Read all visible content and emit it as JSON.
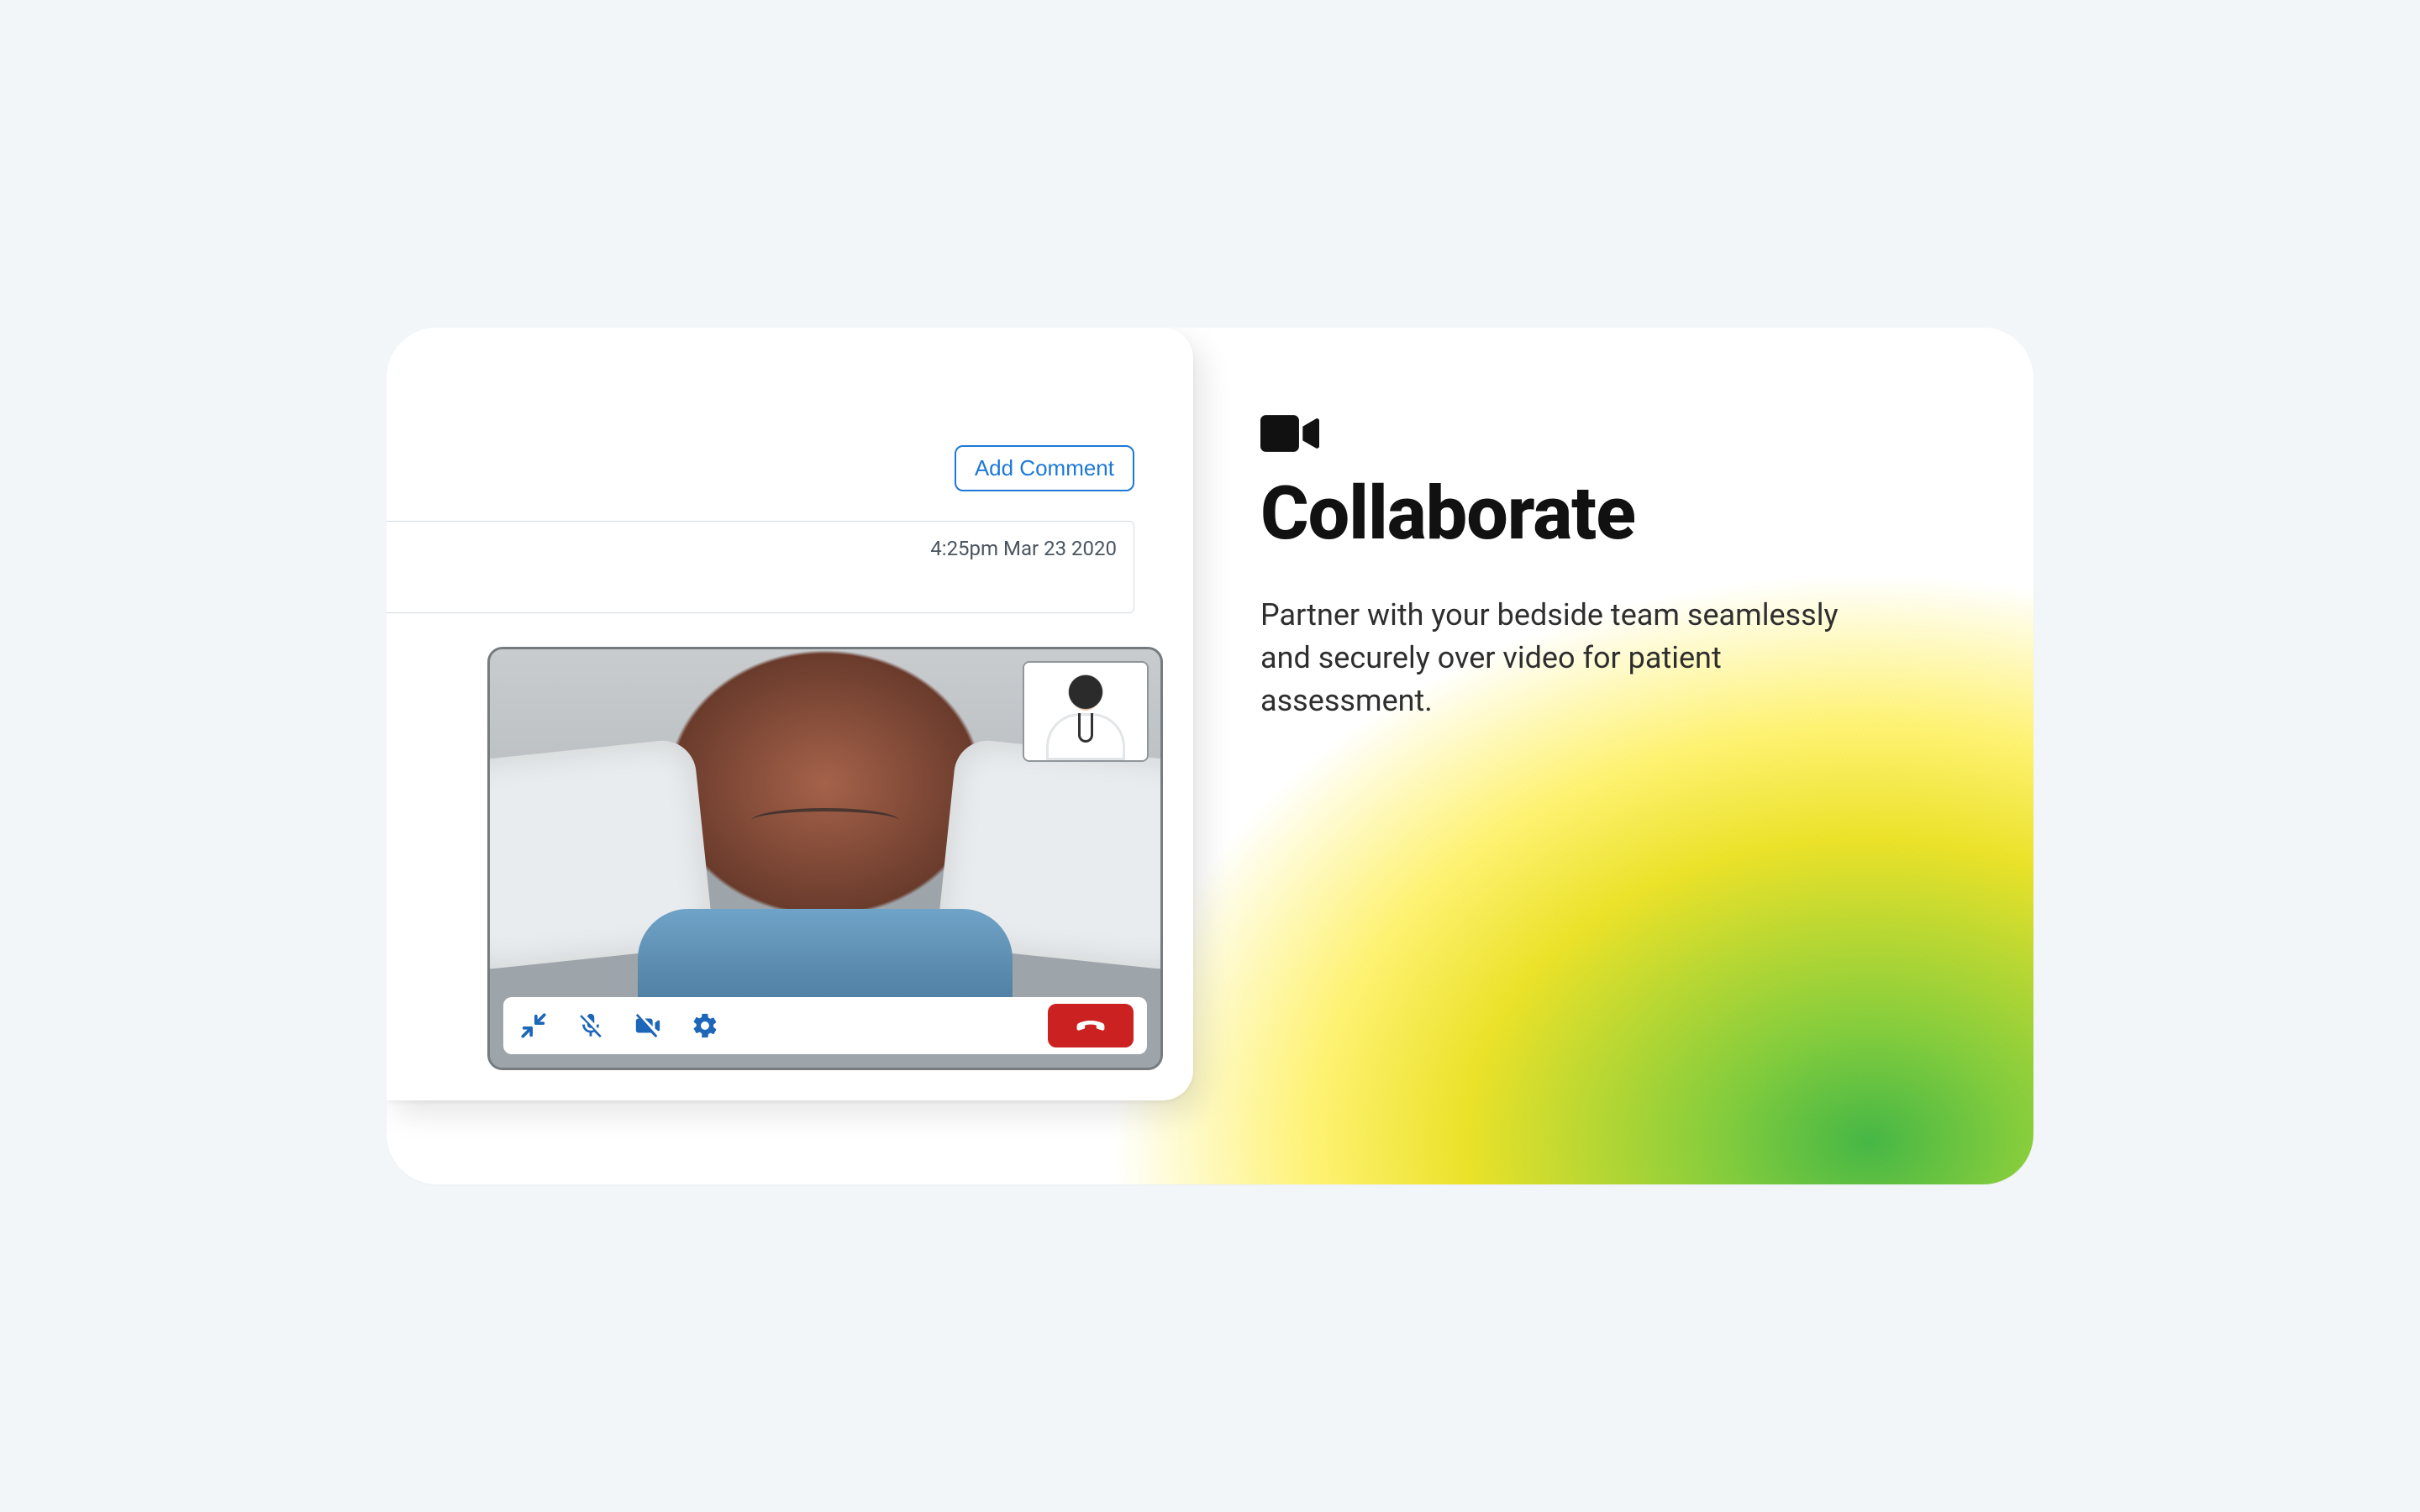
{
  "app": {
    "add_comment_label": "Add Comment",
    "timestamp": "4:25pm Mar 23 2020"
  },
  "video_controls": {
    "minimize": "minimize-icon",
    "mute_mic": "mic-off-icon",
    "camera_off": "camera-off-icon",
    "settings": "gear-icon",
    "hangup": "hangup-icon"
  },
  "feature": {
    "icon": "video-camera-icon",
    "title": "Collaborate",
    "description": "Partner with your bedside team seamlessly and securely over video for patient assessment."
  },
  "colors": {
    "accent_blue": "#1d78d6",
    "hangup_red": "#cc2121",
    "gradient_yellow": "#f2e33a",
    "gradient_green": "#3cb43c"
  }
}
